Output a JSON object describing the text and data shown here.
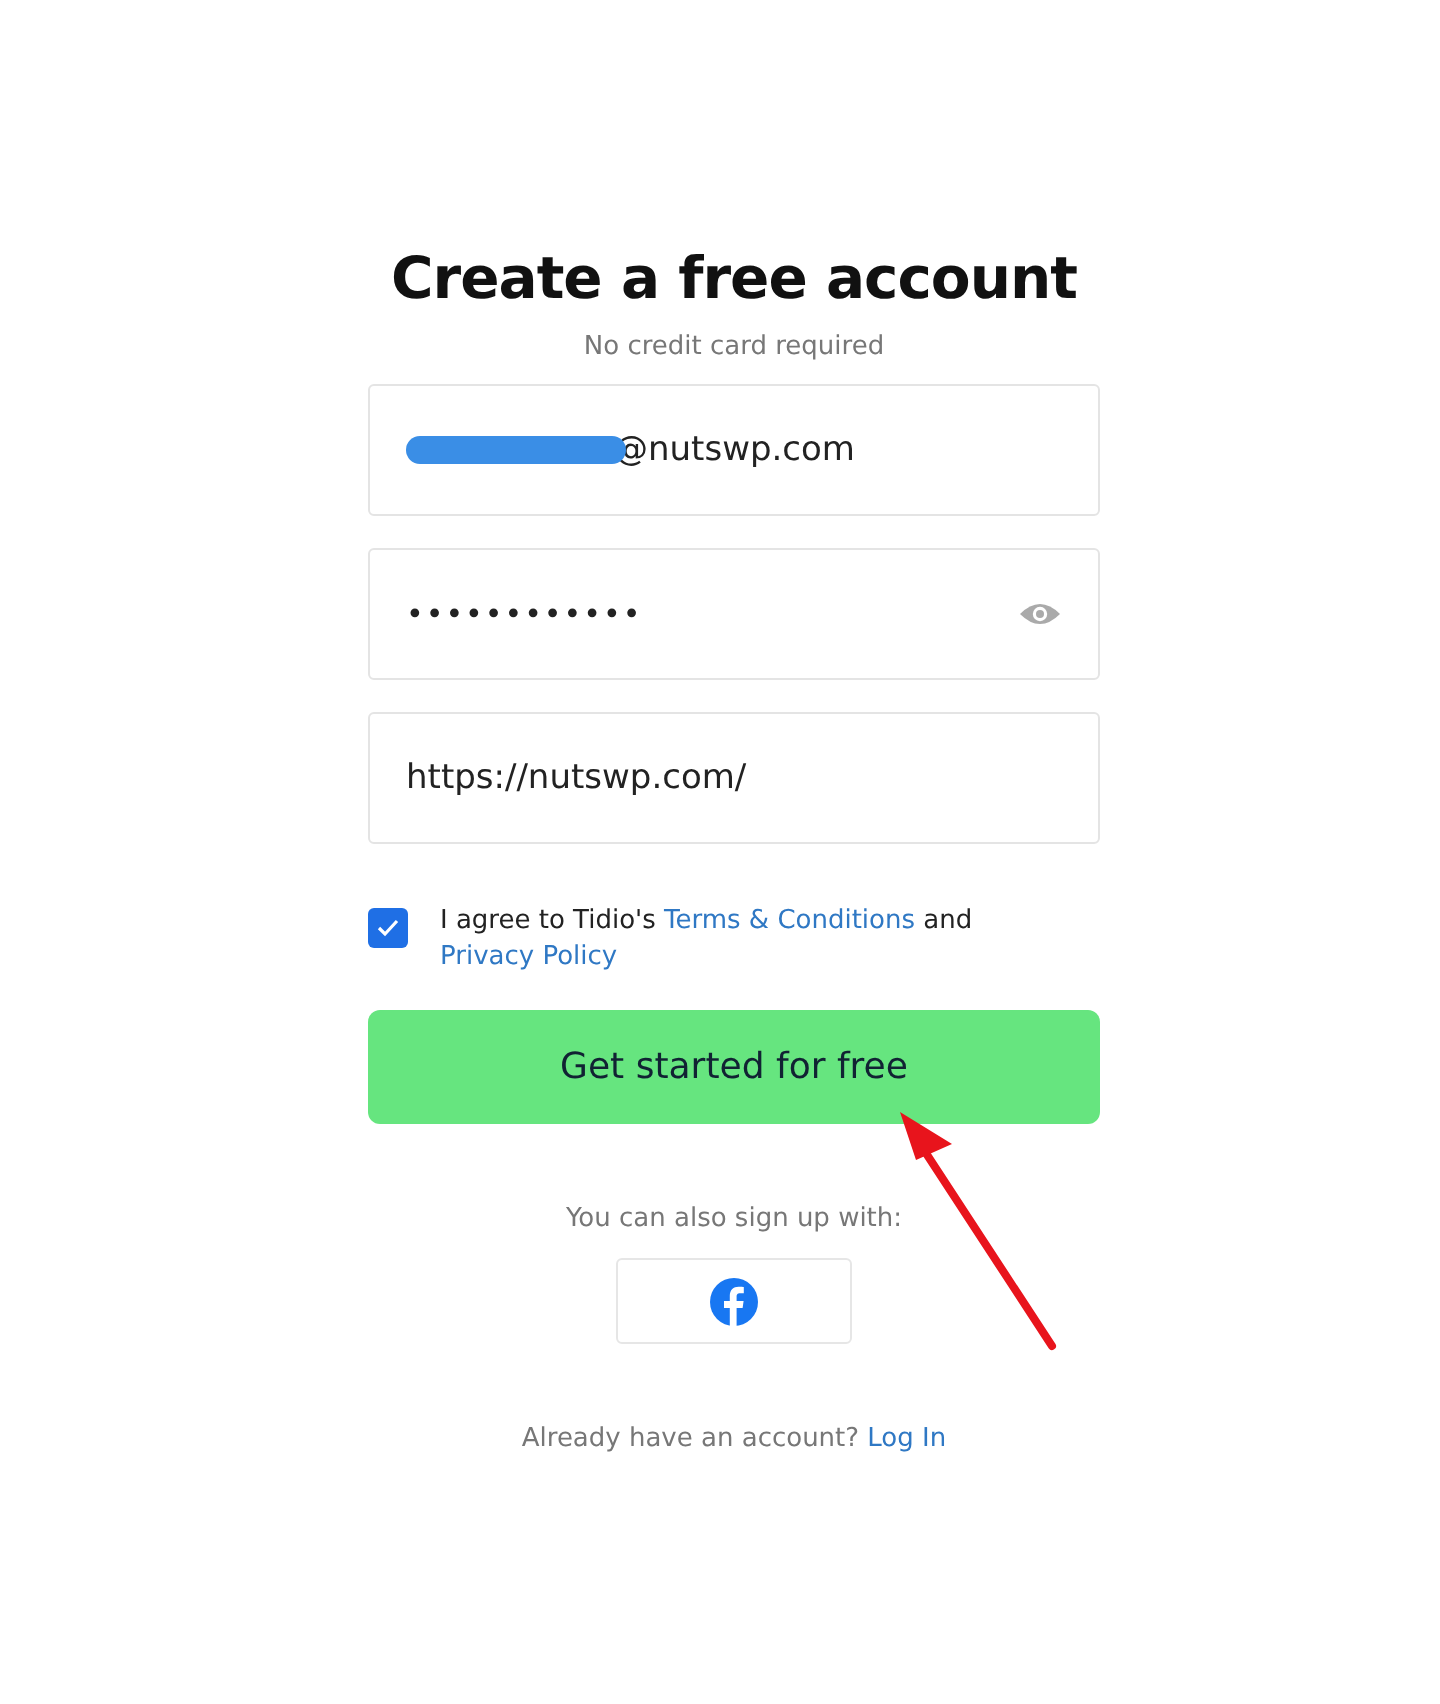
{
  "title": "Create a free account",
  "subtitle": "No credit card required",
  "fields": [
    {
      "kind": "email",
      "value": "@nutswp.com",
      "redacted": true
    },
    {
      "kind": "password",
      "value": "••••••••••••"
    },
    {
      "kind": "url",
      "value": "https://nutswp.com/"
    }
  ],
  "agreement": {
    "checked": true,
    "text": "I agree to Tidio's ",
    "terms_link": "Terms & Conditions",
    "joiner": " and ",
    "privacy_link": "Privacy Policy"
  },
  "submit_button": "Get started for free",
  "social_prompt": "You can also sign up with:",
  "social_buttons": [
    {
      "kind": "facebook"
    }
  ],
  "login_prompt": {
    "text": "Already have an account? ",
    "link": "Log In"
  },
  "annotations": [
    {
      "kind": "arrow"
    }
  ]
}
